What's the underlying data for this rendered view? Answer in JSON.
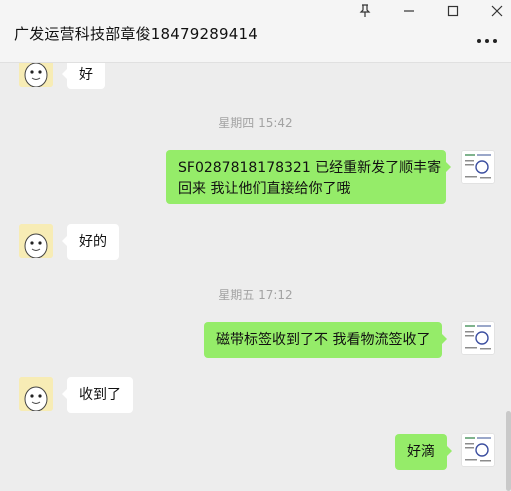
{
  "header": {
    "title": "广发运营科技部章俊18479289414"
  },
  "window_controls": {
    "icons": [
      "pin-icon",
      "minimize-icon",
      "maximize-icon",
      "close-icon"
    ]
  },
  "messages": [
    {
      "sender": "contact",
      "text": "好"
    },
    {
      "type": "timestamp",
      "text": "星期四 15:42"
    },
    {
      "sender": "self",
      "line1": "SF0287818178321  已经重新发了顺丰寄",
      "line2": "回来 我让他们直接给你了哦"
    },
    {
      "sender": "contact",
      "text": "好的"
    },
    {
      "type": "timestamp",
      "text": "星期五 17:12"
    },
    {
      "sender": "self",
      "text": "磁带标签收到了不  我看物流签收了"
    },
    {
      "sender": "contact",
      "text": "收到了"
    },
    {
      "sender": "self",
      "text": "好滴"
    }
  ],
  "colors": {
    "incoming_bubble": "#ffffff",
    "outgoing_bubble": "#95ec69",
    "background": "#ededed"
  }
}
